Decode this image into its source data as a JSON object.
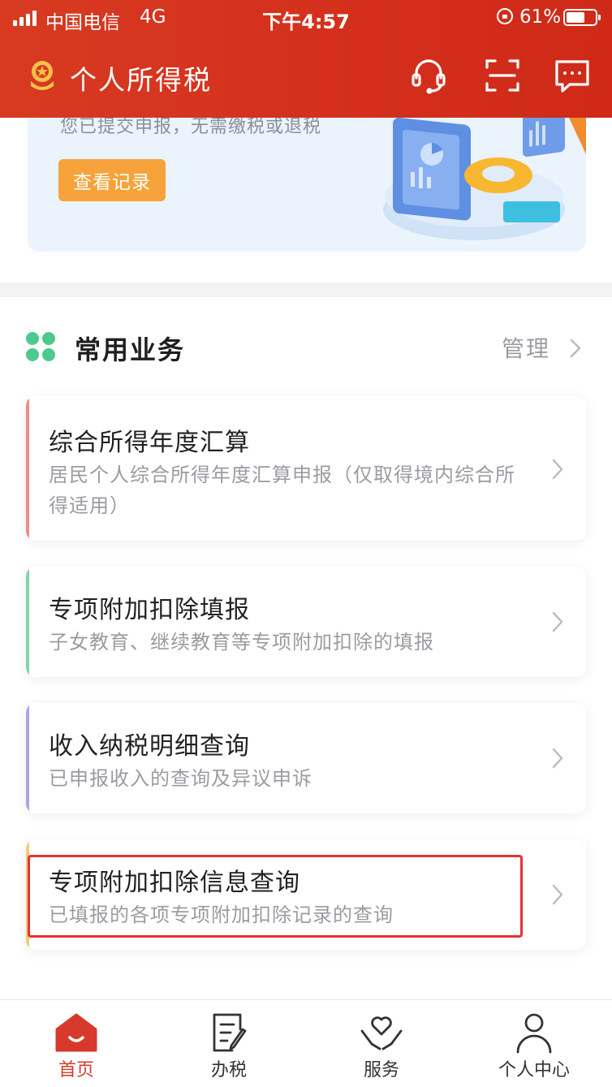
{
  "status_bar": {
    "carrier": "中国电信",
    "network": "4G",
    "time": "下午4:57",
    "battery": "61%"
  },
  "header": {
    "title": "个人所得税",
    "icons": [
      "emblem-icon",
      "support-icon",
      "scan-icon",
      "message-icon"
    ]
  },
  "banner": {
    "subtext": "您已提交申报，无需缴税或退税",
    "button": "查看记录"
  },
  "services": {
    "title": "常用业务",
    "manage": "管理",
    "items": [
      {
        "title": "综合所得年度汇算",
        "desc": "居民个人综合所得年度汇算申报（仅取得境内综合所得适用）",
        "accent": "#f08a8a"
      },
      {
        "title": "专项附加扣除填报",
        "desc": "子女教育、继续教育等专项附加扣除的填报",
        "accent": "#7fd6a6"
      },
      {
        "title": "收入纳税明细查询",
        "desc": "已申报收入的查询及异议申诉",
        "accent": "#a9a6e6"
      },
      {
        "title": "专项附加扣除信息查询",
        "desc": "已填报的各项专项附加扣除记录的查询",
        "accent": "#f5c977",
        "highlighted": true
      }
    ]
  },
  "bottom_nav": [
    {
      "label": "首页",
      "icon": "home-icon",
      "active": true
    },
    {
      "label": "办税",
      "icon": "tax-document-icon",
      "active": false
    },
    {
      "label": "服务",
      "icon": "heart-hands-icon",
      "active": false
    },
    {
      "label": "个人中心",
      "icon": "user-icon",
      "active": false
    }
  ],
  "colors": {
    "header_red": "#d32f1c",
    "active_red": "#d73a2a",
    "button_orange": "#f6a33b",
    "highlight_red": "#e63232",
    "services_green": "#4dc98d"
  }
}
